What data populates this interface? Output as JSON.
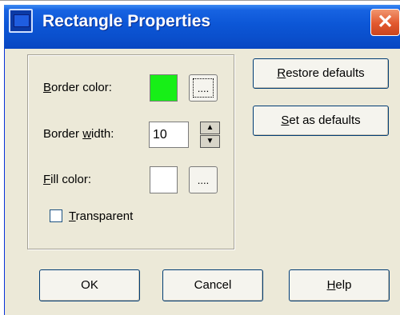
{
  "window": {
    "title": "Rectangle Properties",
    "close_glyph": "✕",
    "icon": "window-app-icon"
  },
  "fields": {
    "border_color": {
      "label_mn": "B",
      "label_rest": "order color:",
      "value": "#17ef17",
      "button_label": "...."
    },
    "border_width": {
      "label_pre": "Border ",
      "label_mn": "w",
      "label_rest": "idth:",
      "value": "10"
    },
    "fill_color": {
      "label_mn": "F",
      "label_rest": "ill color:",
      "value": "#ffffff",
      "button_label": "...."
    },
    "transparent": {
      "label_mn": "T",
      "label_rest": "ransparent",
      "checked": false
    }
  },
  "side_buttons": {
    "restore": {
      "mn": "R",
      "rest": "estore defaults"
    },
    "set": {
      "mn": "S",
      "rest": "et as defaults"
    }
  },
  "bottom_buttons": {
    "ok": "OK",
    "cancel": "Cancel",
    "help": {
      "mn": "H",
      "rest": "elp"
    }
  },
  "colors": {
    "title_bar": "#0a4fcc",
    "dialog_bg": "#ece9d8",
    "border_swatch": "#17ef17"
  }
}
